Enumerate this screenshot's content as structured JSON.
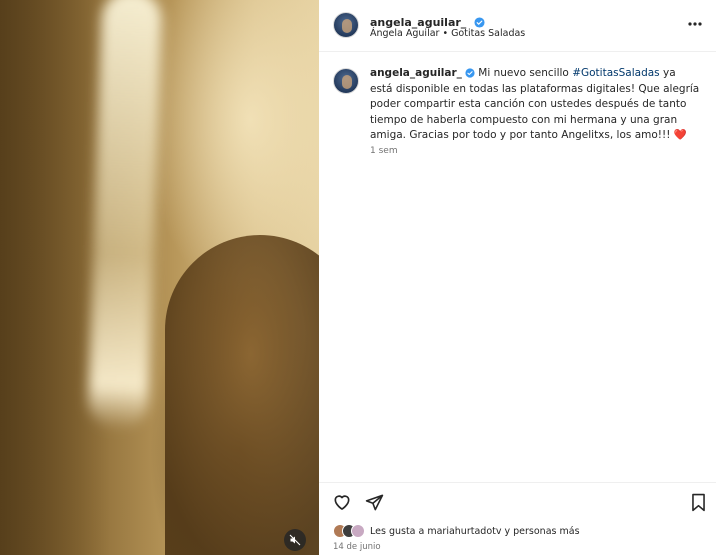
{
  "post": {
    "username": "angela_aguilar_",
    "subtitle": "Ángela Aguilar • Gotitas Saladas",
    "caption_prefix": "Mi nuevo sencillo ",
    "hashtag": "#GotitasSaladas",
    "caption_body": " ya está disponible en todas las plataformas digitales! Que alegría poder compartir esta canción con ustedes después de tanto tiempo de haberla compuesto con mi hermana y una gran amiga. Gracias por todo y por tanto Angelitxs, los amo!!! ",
    "caption_emoji": "❤️",
    "timestamp": "1 sem",
    "likes_text": "Les gusta a mariahurtadotv y personas más",
    "date": "14 de junio"
  },
  "colors": {
    "verified": "#3897f0",
    "hashtag": "#00376b",
    "heart": "#e0245e"
  },
  "icons": [
    "verified-badge-icon",
    "more-options-icon",
    "heart-icon",
    "share-icon",
    "bookmark-icon",
    "mute-icon"
  ]
}
